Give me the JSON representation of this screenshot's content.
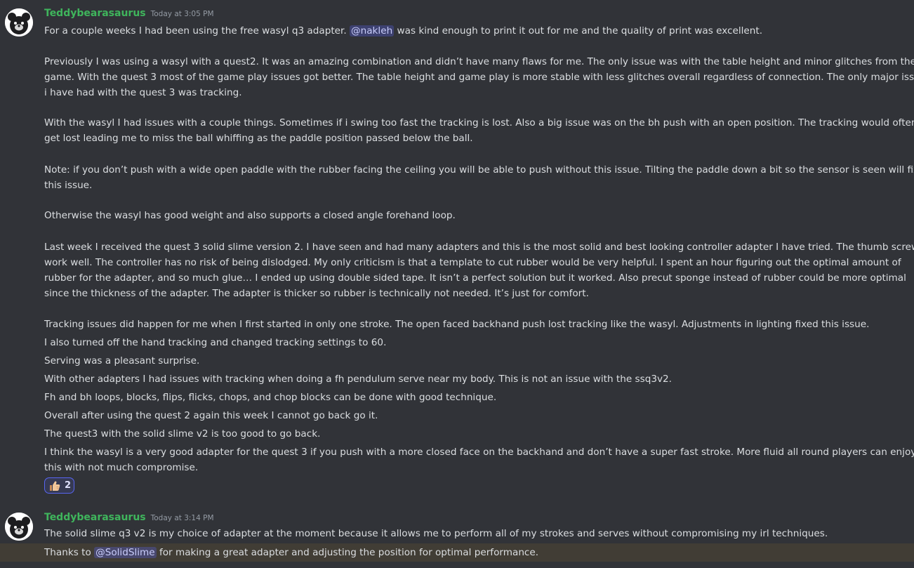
{
  "messages": [
    {
      "username": "Teddybearasaurus",
      "timestamp": "Today at 3:05 PM",
      "intro_before": "For a couple weeks I had been using the free wasyl q3 adapter. ",
      "intro_mention": "@nakleh",
      "intro_after": " was kind enough to print it out for me and the quality of print was excellent.",
      "lines": [
        "Previously I was using a wasyl with a quest2. It was an amazing combination and didn’t have many flaws for me. The only issue was with the table height and minor glitches from the",
        "game. With the quest 3 most of the game play issues got better. The table height and game play is more stable with less glitches overall regardless of connection. The only major issue",
        "i have had with the quest 3 was tracking.",
        "With the wasyl I had issues with a couple things. Sometimes if i swing too fast the tracking is lost. Also a big issue was on the bh push with an open position. The tracking would often",
        "get lost leading me to miss the ball whiffing as the paddle position passed below the ball.",
        "Note: if you don’t push with a wide open paddle with the rubber facing the ceiling you will be able to push without this issue. Tilting the paddle down a bit so the sensor is seen will fix",
        "this issue.",
        "Otherwise the wasyl has good weight and also supports a closed angle forehand loop.",
        "Last week I received the quest 3 solid slime version 2. I have seen and had many adapters and this is the most solid and best looking controller adapter I have tried. The thumb screws",
        "work well. The controller has no risk of being dislodged. My only criticism is that a template to cut rubber would be very helpful. I spent an hour figuring out the optimal amount of",
        "rubber for the adapter, and so much glue… I ended up using double sided tape. It isn’t a perfect solution but it worked. Also precut sponge instead of rubber could be more optimal",
        "since the thickness of the adapter. The adapter is thicker so rubber is technically not needed. It’s just for comfort.",
        "Tracking issues did happen for me when I first started in only one stroke. The open faced backhand push lost tracking like the wasyl. Adjustments in lighting fixed this issue.",
        "I also turned off the hand tracking and changed tracking settings to 60.",
        "Serving was a pleasant surprise.",
        "With other adapters I had issues with tracking when doing a fh pendulum serve near my body. This is not an issue with the ssq3v2.",
        "Fh and bh loops, blocks, flips, flicks, chops, and chop blocks can be done with good technique.",
        "Overall after using the quest 2 again this week I cannot go back go it.",
        "The quest3 with the solid slime v2 is too good to go back.",
        "I think the wasyl is a very good adapter for the quest 3 if you push with a more closed face on the backhand and don’t have a super fast stroke. More fluid all round players can enjoy",
        "this with not much compromise."
      ],
      "reaction": {
        "emoji": "thumbs-up-icon",
        "count": "2"
      }
    },
    {
      "username": "Teddybearasaurus",
      "timestamp": "Today at 3:14 PM",
      "line1": "The solid slime q3 v2 is my choice of adapter at the moment because it allows me to perform all of my strokes and serves without compromising my irl techniques.",
      "line2_before": "Thanks to ",
      "line2_mention": "@SolidSlime",
      "line2_after": " for making a great adapter and adjusting the position for optimal performance."
    }
  ],
  "colors": {
    "background": "#313338",
    "username": "#3fb55c",
    "text": "#dbdee1",
    "mention_bg": "#3c4270",
    "highlight": "#413d35"
  }
}
